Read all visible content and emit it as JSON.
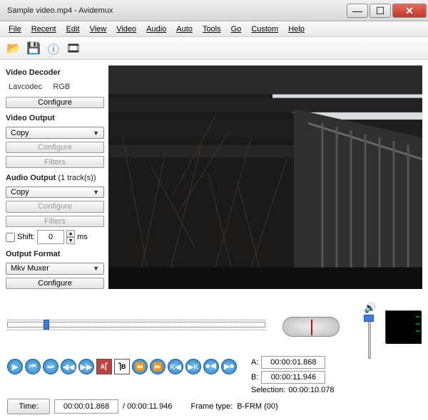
{
  "titlebar": {
    "title": "Sample video.mp4 - Avidemux"
  },
  "menu": {
    "items": [
      "File",
      "Recent",
      "Edit",
      "View",
      "Video",
      "Audio",
      "Auto",
      "Tools",
      "Go",
      "Custom",
      "Help"
    ]
  },
  "toolbar": {
    "icons": [
      "open-icon",
      "save-icon",
      "info-icon",
      "project-icon"
    ]
  },
  "left": {
    "video_decoder": {
      "title": "Video Decoder",
      "codec": "Lavcodec",
      "color": "RGB",
      "configure": "Configure"
    },
    "video_output": {
      "title": "Video Output",
      "value": "Copy",
      "configure": "Configure",
      "filters": "Filters"
    },
    "audio_output": {
      "title": "Audio Output",
      "tracks": "(1 track(s))",
      "value": "Copy",
      "configure": "Configure",
      "filters": "Filters",
      "shift_label": "Shift:",
      "shift_value": "0",
      "shift_unit": "ms"
    },
    "output_format": {
      "title": "Output Format",
      "value": "Mkv Muxer",
      "configure": "Configure"
    }
  },
  "timeline": {
    "handle_left_pct": 14
  },
  "marks": {
    "a_label": "A:",
    "a_value": "00:00:01.868",
    "b_label": "B:",
    "b_value": "00:00:11.946",
    "sel_label": "Selection:",
    "sel_value": "00:00:10.078"
  },
  "status": {
    "time_label": "Time:",
    "time_value": "00:00:01.868",
    "total": "/ 00:00:11.946",
    "frametype_label": "Frame type:",
    "frametype_value": "B-FRM (00)"
  }
}
